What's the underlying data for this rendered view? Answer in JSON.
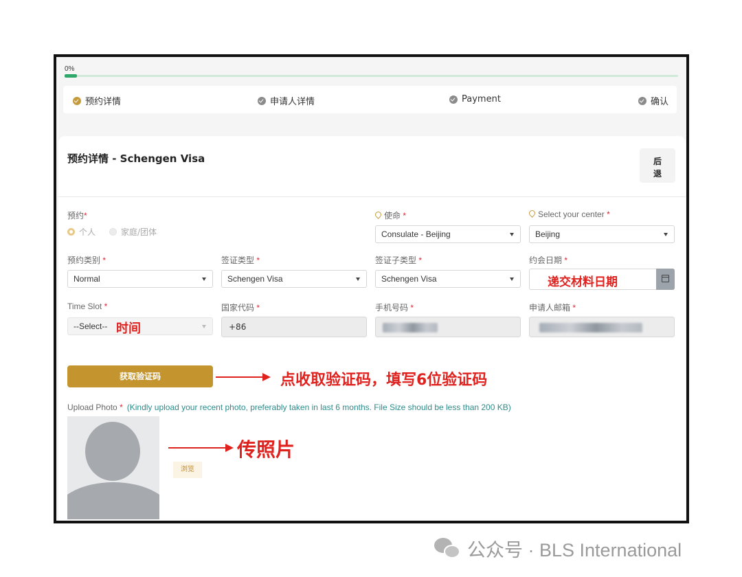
{
  "progress": {
    "percent_text": "0%",
    "value": 0
  },
  "steps": [
    {
      "label": "预约详情",
      "active": true
    },
    {
      "label": "申请人详情",
      "active": false
    },
    {
      "label": "Payment",
      "active": false
    },
    {
      "label": "确认",
      "active": false
    }
  ],
  "card": {
    "title": "预约详情 - Schengen Visa",
    "back_label_line1": "后",
    "back_label_line2": "退"
  },
  "form": {
    "appointment_for": {
      "label": "预约",
      "required": "*",
      "options": [
        "个人",
        "家庭/团体"
      ],
      "selected": "个人"
    },
    "mission": {
      "label": "使命",
      "required": "*",
      "value": "Consulate - Beijing"
    },
    "center": {
      "label": "Select your center",
      "required": "*",
      "value": "Beijing"
    },
    "appointment_category": {
      "label": "预约类别",
      "required": "*",
      "value": "Normal"
    },
    "visa_type": {
      "label": "签证类型",
      "required": "*",
      "value": "Schengen Visa"
    },
    "visa_subtype": {
      "label": "签证子类型",
      "required": "*",
      "value": "Schengen Visa"
    },
    "appointment_date": {
      "label": "约会日期",
      "required": "*",
      "value": ""
    },
    "time_slot": {
      "label": "Time Slot",
      "required": "*",
      "value": "--Select--"
    },
    "country_code": {
      "label": "国家代码",
      "required": "*",
      "value": "+86"
    },
    "mobile": {
      "label": "手机号码",
      "required": "*"
    },
    "email": {
      "label": "申请人邮箱",
      "required": "*"
    },
    "verify_button": "获取验证码",
    "upload_photo": {
      "label": "Upload Photo",
      "required": "*",
      "hint": "(Kindly upload your recent photo, preferably taken in last 6 months. File Size should be less than 200 KB)",
      "browse_label": "浏览"
    }
  },
  "annotations": {
    "date": "递交材料日期",
    "time": "时间",
    "verify": "点收取验证码，填写6位验证码",
    "photo": "传照片"
  },
  "footer": {
    "text": "公众号 · BLS International"
  },
  "colors": {
    "accent": "#c4942f",
    "progress": "#2ea86a",
    "annotation": "#e0221f",
    "hint": "#2d8a8a"
  }
}
